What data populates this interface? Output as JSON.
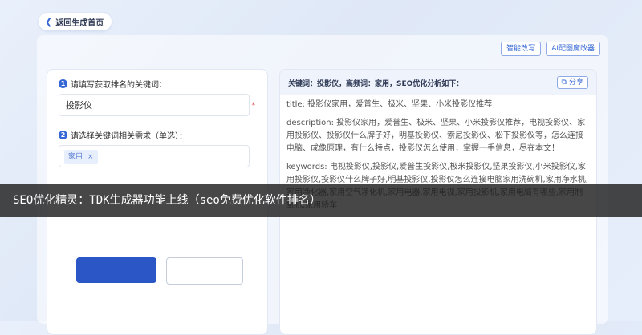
{
  "back_label": "返回生成首页",
  "top_actions": [
    "智能改写",
    "AI配图魔改器"
  ],
  "form": {
    "step1_num": "1",
    "step1_label": "请填写获取排名的关键词：",
    "keyword_value": "投影仪",
    "required_mark": "*",
    "step2_num": "2",
    "step2_label": "请选择关键词相关需求（单选）：",
    "tag_label": "家用",
    "tag_remove": "×"
  },
  "result": {
    "header": "关键词：投影仪，高频词：家用，SEO优化分析如下：",
    "share_label": "分享",
    "title_line": "title:  投影仪家用，爱普生、极米、坚果、小米投影仪推荐",
    "description_line": "description:  投影仪家用，爱普生、极米、坚果、小米投影仪推荐，电视投影仪、家用投影仪、投影仪什么牌子好，明基投影仪、索尼投影仪、松下投影仪等，怎么连接电脑、成像原理，有什么特点，投影仪怎么使用，掌握一手信息，尽在本文！",
    "keywords_line": "keywords: 电视投影仪,投影仪,爱普生投影仪,极米投影仪,坚果投影仪,小米投影仪,家用投影仪,投影仪什么牌子好,明基投影仪,投影仪怎么连接电脑家用洗碗机,家用净水机,家用净化器,家用空气净化机,家用电器,家用电视,家用投影机,家用电脑有哪些,家用制氧机,家用轿车"
  },
  "banner_text": "SEO优化精灵：TDK生成器功能上线（seo免费优化软件排名）"
}
